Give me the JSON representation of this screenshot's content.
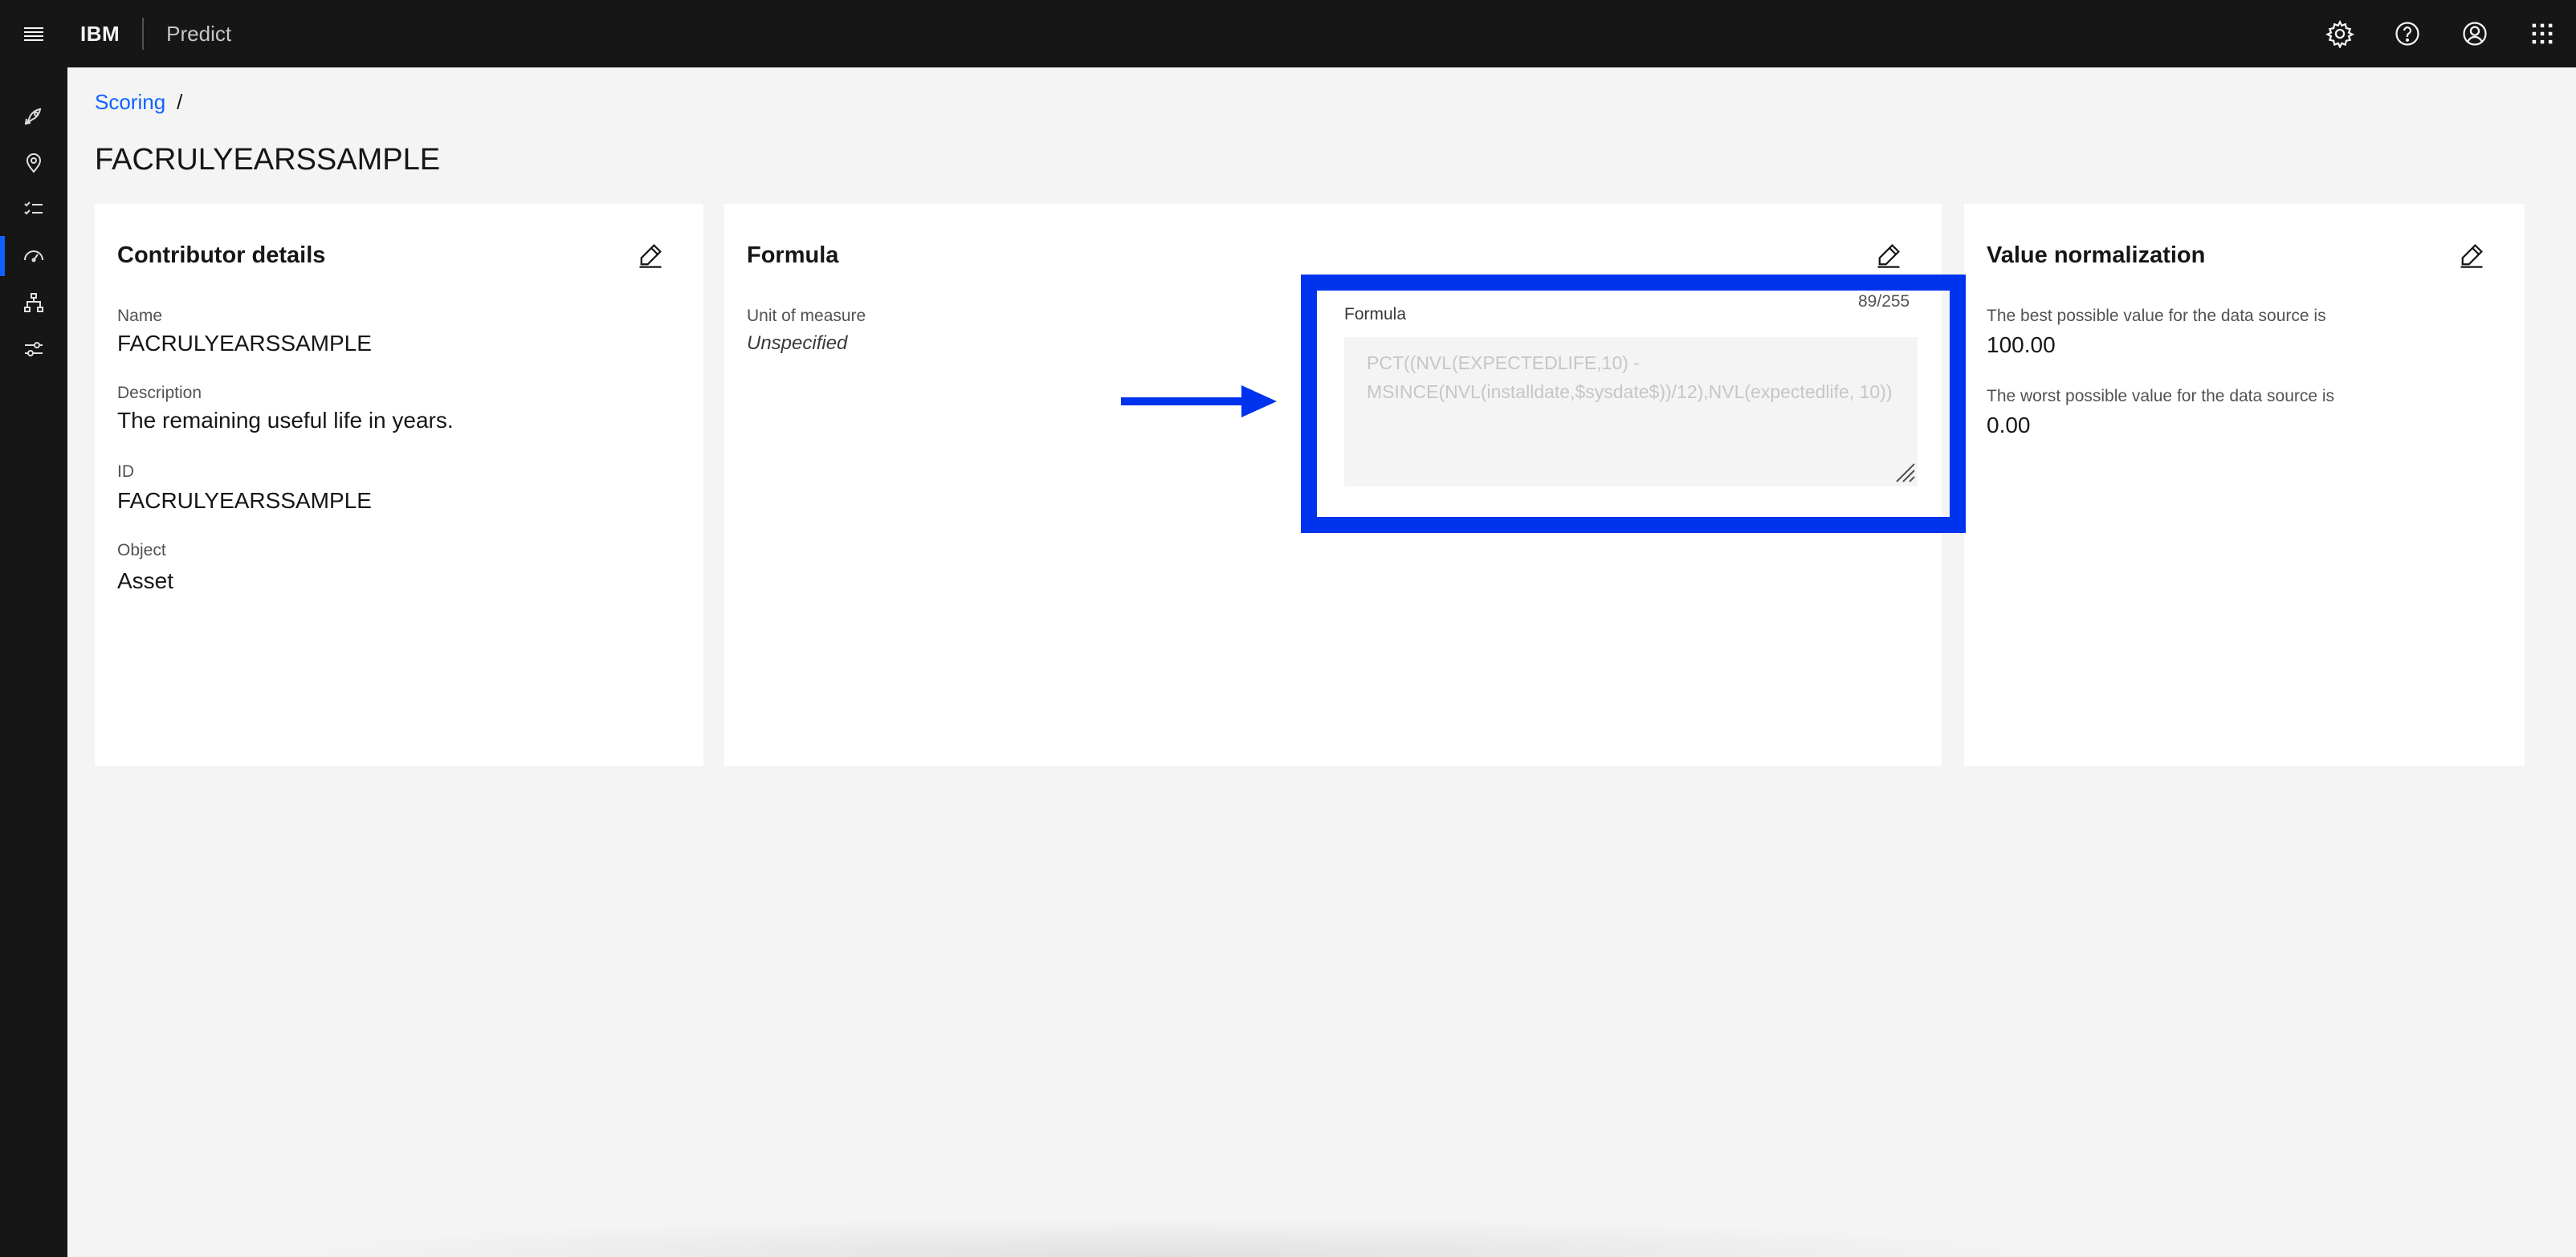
{
  "header": {
    "brand": "IBM",
    "product": "Predict",
    "menu_icon": "hamburger-menu-icon",
    "actions": [
      "settings-icon",
      "help-icon",
      "user-avatar-icon",
      "app-switcher-icon"
    ]
  },
  "sidenav": {
    "items": [
      {
        "icon": "rocket-icon"
      },
      {
        "icon": "location-icon"
      },
      {
        "icon": "checklist-icon"
      },
      {
        "icon": "dashboard-gauge-icon",
        "active": true
      },
      {
        "icon": "hierarchy-icon"
      },
      {
        "icon": "settings-adjust-icon"
      }
    ]
  },
  "breadcrumb": {
    "items": [
      "Scoring"
    ],
    "separator": "/"
  },
  "page_title": "FACRULYEARSSAMPLE",
  "contributor": {
    "title": "Contributor details",
    "name_label": "Name",
    "name_value": "FACRULYEARSSAMPLE",
    "description_label": "Description",
    "description_value": "The remaining useful life in years.",
    "id_label": "ID",
    "id_value": "FACRULYEARSSAMPLE",
    "object_label": "Object",
    "object_value": "Asset"
  },
  "formula_card": {
    "title": "Formula",
    "unit_label": "Unit of measure",
    "unit_value": "Unspecified",
    "formula_label": "Formula",
    "formula_count": "89/255",
    "formula_value": "PCT((NVL(EXPECTEDLIFE,10) - MSINCE(NVL(installdate,$sysdate$))/12),NVL(expectedlife, 10))"
  },
  "normalization": {
    "title": "Value normalization",
    "best_label": "The best possible value for the data source is",
    "best_value": "100.00",
    "worst_label": "The worst possible value for the data source is",
    "worst_value": "0.00"
  },
  "colors": {
    "header_bg": "#161616",
    "page_bg": "#f4f4f4",
    "link": "#0f62fe",
    "highlight": "#0033ee"
  }
}
